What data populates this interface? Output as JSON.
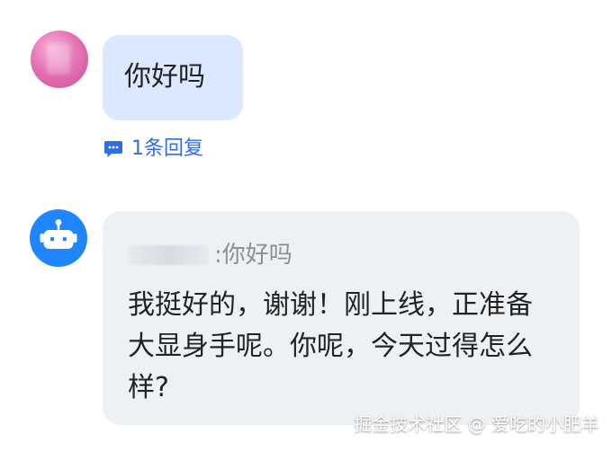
{
  "messages": [
    {
      "text": "你好吗",
      "reply_count_label": "1条回复",
      "colors": {
        "bubble": "#dbe8ff",
        "reply_link": "#2f6ee8"
      }
    },
    {
      "quote_prefix": ": ",
      "quote_text": "你好吗",
      "text": "我挺好的，谢谢！刚上线，正准备大显身手呢。你呢，今天过得怎么样?",
      "colors": {
        "bubble": "#eef1f4",
        "avatar": "#1f86ff"
      }
    }
  ],
  "icons": {
    "reply_icon": "chat-bubble-icon",
    "bot_avatar_icon": "robot-icon"
  },
  "watermark": "掘金技术社区 @ 爱吃的小肥羊"
}
